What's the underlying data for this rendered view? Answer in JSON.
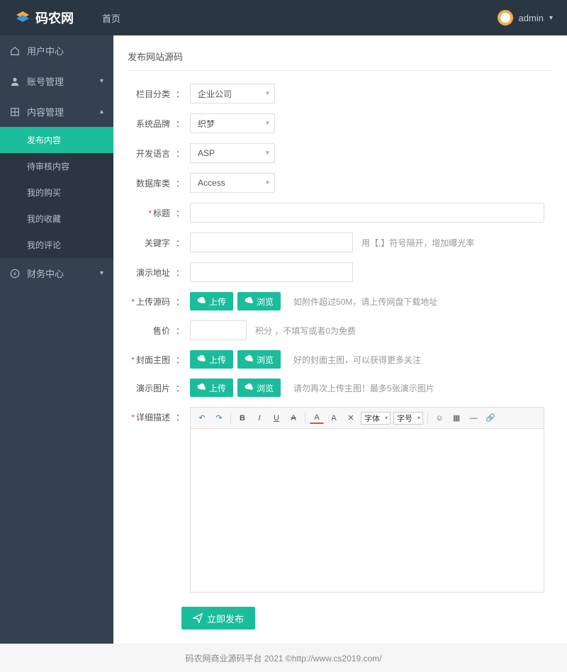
{
  "header": {
    "brand": "码农网",
    "nav_home": "首页",
    "user": "admin"
  },
  "sidebar": {
    "items": [
      {
        "label": "用户中心",
        "icon": "home"
      },
      {
        "label": "账号管理",
        "icon": "user",
        "expandable": true
      },
      {
        "label": "内容管理",
        "icon": "grid",
        "expandable": true,
        "expanded": true
      },
      {
        "label": "财务中心",
        "icon": "yen",
        "expandable": true
      }
    ],
    "content_sub": [
      {
        "label": "发布内容",
        "active": true
      },
      {
        "label": "待审核内容"
      },
      {
        "label": "我的购买"
      },
      {
        "label": "我的收藏"
      },
      {
        "label": "我的评论"
      }
    ]
  },
  "page": {
    "tab_title": "发布网站源码",
    "fields": {
      "category_label": "栏目分类",
      "category_value": "企业公司",
      "brand_label": "系统品牌",
      "brand_value": "织梦",
      "lang_label": "开发语言",
      "lang_value": "ASP",
      "db_label": "数据库类",
      "db_value": "Access",
      "title_label": "标题",
      "keywords_label": "关键字",
      "keywords_hint": "用【,】符号隔开，增加曝光率",
      "demo_label": "演示地址",
      "upload_label": "上传源码",
      "upload_hint": "如附件超过50M，请上传网盘下载地址",
      "price_label": "售价",
      "price_hint": "积分 ，不填写或者0为免费",
      "cover_label": "封面主图",
      "cover_hint": "好的封面主图，可以获得更多关注",
      "gallery_label": "演示图片",
      "gallery_hint": "请勿再次上传主图！最多5张演示图片",
      "desc_label": "详细描述"
    },
    "buttons": {
      "upload": "上传",
      "browse": "浏览",
      "submit": "立即发布"
    },
    "editor_toolbar": {
      "font_select": "字体",
      "size_select": "字号"
    }
  },
  "footer": {
    "text_prefix": "码农网商业源码平台 2021 © ",
    "link": "http://www.cs2019.com/"
  }
}
